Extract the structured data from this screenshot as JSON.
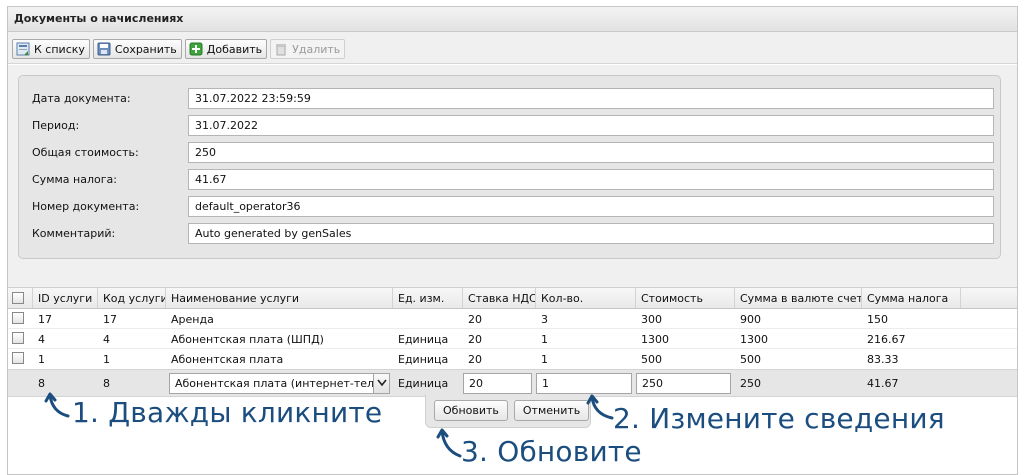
{
  "panel": {
    "title": "Документы о начислениях"
  },
  "toolbar": {
    "buttons": [
      {
        "label": "К списку",
        "icon": "back-to-list-icon"
      },
      {
        "label": "Сохранить",
        "icon": "save-icon"
      },
      {
        "label": "Добавить",
        "icon": "add-icon"
      },
      {
        "label": "Удалить",
        "icon": "delete-icon",
        "disabled": true
      }
    ]
  },
  "form": {
    "fields": [
      {
        "label": "Дата документа:",
        "value": "31.07.2022 23:59:59"
      },
      {
        "label": "Период:",
        "value": "31.07.2022"
      },
      {
        "label": "Общая стоимость:",
        "value": "250"
      },
      {
        "label": "Сумма налога:",
        "value": "41.67"
      },
      {
        "label": "Номер документа:",
        "value": "default_operator36"
      },
      {
        "label": "Комментарий:",
        "value": "Auto generated by genSales"
      }
    ]
  },
  "grid": {
    "columns": [
      "ID услуги",
      "Код услуги",
      "Наименование услуги",
      "Ед. изм.",
      "Ставка НДС",
      "Кол-во.",
      "Стоимость",
      "Сумма в валюте счета",
      "Сумма налога"
    ],
    "rows": [
      [
        "17",
        "17",
        "Аренда",
        "",
        "20",
        "3",
        "300",
        "900",
        "150"
      ],
      [
        "4",
        "4",
        "Абонентская плата (ШПД)",
        "Единица",
        "20",
        "1",
        "1300",
        "1300",
        "216.67"
      ],
      [
        "1",
        "1",
        "Абонентская плата",
        "Единица",
        "20",
        "1",
        "500",
        "500",
        "83.33"
      ]
    ],
    "edit_row": {
      "id": "8",
      "code": "8",
      "name": "Абонентская плата (интернет-телефония)",
      "unit": "Единица",
      "vat": "20",
      "qty": "1",
      "cost": "250",
      "sum": "250",
      "tax": "41.67"
    },
    "update_label": "Обновить",
    "cancel_label": "Отменить"
  },
  "annotations": {
    "step1": "1. Дважды кликните",
    "step2": "2. Измените сведения",
    "step3": "3. Обновите"
  },
  "colors": {
    "annotation": "#1b4d7f",
    "edit_row_bg": "#e6e6e6"
  }
}
